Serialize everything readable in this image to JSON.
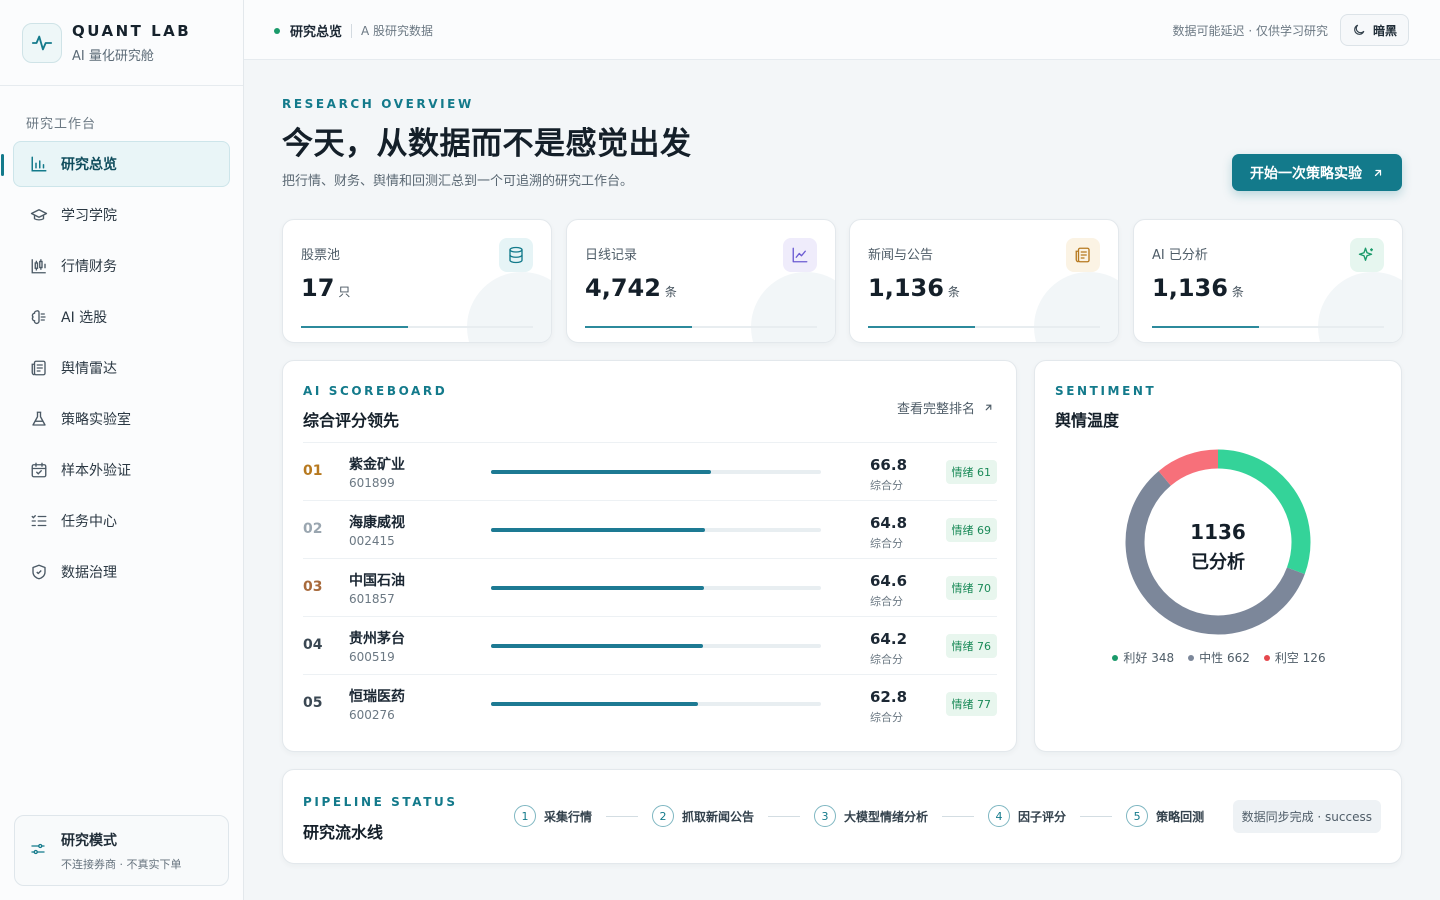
{
  "brand": {
    "name": "QUANT LAB",
    "subtitle": "AI 量化研究舱"
  },
  "sidebar": {
    "section_label": "研究工作台",
    "items": [
      {
        "label": "研究总览",
        "icon": "bar-chart-icon",
        "active": true
      },
      {
        "label": "学习学院",
        "icon": "graduation-cap-icon"
      },
      {
        "label": "行情财务",
        "icon": "candlestick-icon"
      },
      {
        "label": "AI 选股",
        "icon": "brain-icon"
      },
      {
        "label": "舆情雷达",
        "icon": "newspaper-icon"
      },
      {
        "label": "策略实验室",
        "icon": "flask-icon"
      },
      {
        "label": "样本外验证",
        "icon": "calendar-check-icon"
      },
      {
        "label": "任务中心",
        "icon": "list-check-icon"
      },
      {
        "label": "数据治理",
        "icon": "shield-check-icon"
      }
    ],
    "mode": {
      "title": "研究模式",
      "subtitle": "不连接券商 · 不真实下单",
      "icon": "sliders-icon"
    }
  },
  "topbar": {
    "title": "研究总览",
    "subtitle": "A 股研究数据",
    "note": "数据可能延迟 · 仅供学习研究",
    "theme_label": "暗黑",
    "theme_icon": "moon-icon"
  },
  "hero": {
    "eyebrow": "RESEARCH OVERVIEW",
    "title": "今天，从数据而不是感觉出发",
    "subtitle": "把行情、财务、舆情和回测汇总到一个可追溯的研究工作台。",
    "cta_label": "开始一次策略实验"
  },
  "stats": [
    {
      "label": "股票池",
      "value": "17",
      "unit": "只",
      "icon": "database-icon",
      "progress": 0.46,
      "color": "#137a8b",
      "bg": "#e6f4f6"
    },
    {
      "label": "日线记录",
      "value": "4,742",
      "unit": "条",
      "icon": "line-chart-icon",
      "progress": 0.46,
      "color": "#6b5bd2",
      "bg": "#efecfb"
    },
    {
      "label": "新闻与公告",
      "value": "1,136",
      "unit": "条",
      "icon": "newspaper-icon",
      "progress": 0.46,
      "color": "#b7791f",
      "bg": "#fbf3e4"
    },
    {
      "label": "AI 已分析",
      "value": "1,136",
      "unit": "条",
      "icon": "sparkles-icon",
      "progress": 0.46,
      "color": "#1a9a6a",
      "bg": "#e6f6ef"
    }
  ],
  "scoreboard": {
    "eyebrow": "AI SCOREBOARD",
    "title": "综合评分领先",
    "link_label": "查看完整排名",
    "score_label": "综合分",
    "rows": [
      {
        "rank": "01",
        "name": "紫金矿业",
        "code": "601899",
        "score": "66.8",
        "bar": 0.668,
        "badge": "情绪 61",
        "rank_color": "#b7791f"
      },
      {
        "rank": "02",
        "name": "海康威视",
        "code": "002415",
        "score": "64.8",
        "bar": 0.648,
        "badge": "情绪 69",
        "rank_color": "#9aa6b0"
      },
      {
        "rank": "03",
        "name": "中国石油",
        "code": "601857",
        "score": "64.6",
        "bar": 0.646,
        "badge": "情绪 70",
        "rank_color": "#a86a3c"
      },
      {
        "rank": "04",
        "name": "贵州茅台",
        "code": "600519",
        "score": "64.2",
        "bar": 0.642,
        "badge": "情绪 76",
        "rank_color": "#3a4752"
      },
      {
        "rank": "05",
        "name": "恒瑞医药",
        "code": "600276",
        "score": "62.8",
        "bar": 0.628,
        "badge": "情绪 77",
        "rank_color": "#3a4752"
      }
    ]
  },
  "sentiment": {
    "eyebrow": "SENTIMENT",
    "title": "舆情温度",
    "total": "1136",
    "total_label": "已分析",
    "legend": [
      {
        "label": "利好 348",
        "value": 348,
        "color": "#34d399"
      },
      {
        "label": "中性 662",
        "value": 662,
        "color": "#7c879a"
      },
      {
        "label": "利空 126",
        "value": 126,
        "color": "#f7707a"
      }
    ]
  },
  "pipeline": {
    "eyebrow": "PIPELINE STATUS",
    "title": "研究流水线",
    "steps": [
      {
        "num": "1",
        "label": "采集行情"
      },
      {
        "num": "2",
        "label": "抓取新闻公告"
      },
      {
        "num": "3",
        "label": "大模型情绪分析"
      },
      {
        "num": "4",
        "label": "因子评分"
      },
      {
        "num": "5",
        "label": "策略回测"
      }
    ],
    "status": "数据同步完成 · success"
  }
}
